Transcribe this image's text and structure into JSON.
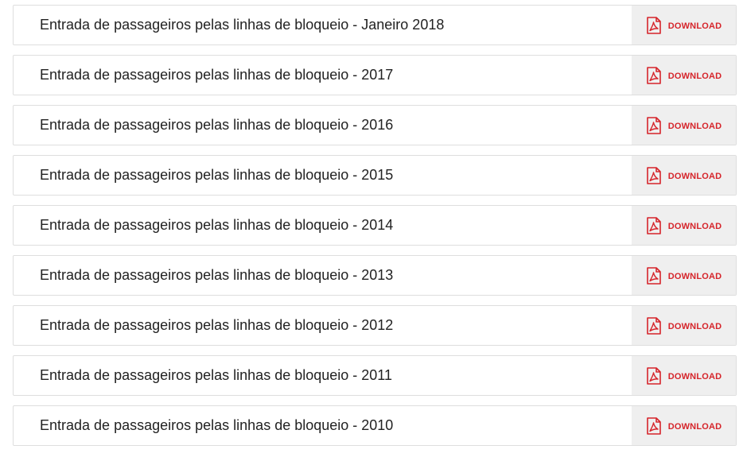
{
  "accent_color": "#d6242a",
  "download_label": "DOWNLOAD",
  "download_icon": "pdf-icon",
  "items": [
    {
      "title": "Entrada de passageiros pelas linhas de bloqueio - Janeiro 2018"
    },
    {
      "title": "Entrada de passageiros pelas linhas de bloqueio - 2017"
    },
    {
      "title": "Entrada de passageiros pelas linhas de bloqueio - 2016"
    },
    {
      "title": "Entrada de passageiros pelas linhas de bloqueio - 2015"
    },
    {
      "title": "Entrada de passageiros pelas linhas de bloqueio - 2014"
    },
    {
      "title": "Entrada de passageiros pelas linhas de bloqueio - 2013"
    },
    {
      "title": "Entrada de passageiros pelas linhas de bloqueio - 2012"
    },
    {
      "title": "Entrada de passageiros pelas linhas de bloqueio - 2011"
    },
    {
      "title": "Entrada de passageiros pelas linhas de bloqueio - 2010"
    }
  ]
}
